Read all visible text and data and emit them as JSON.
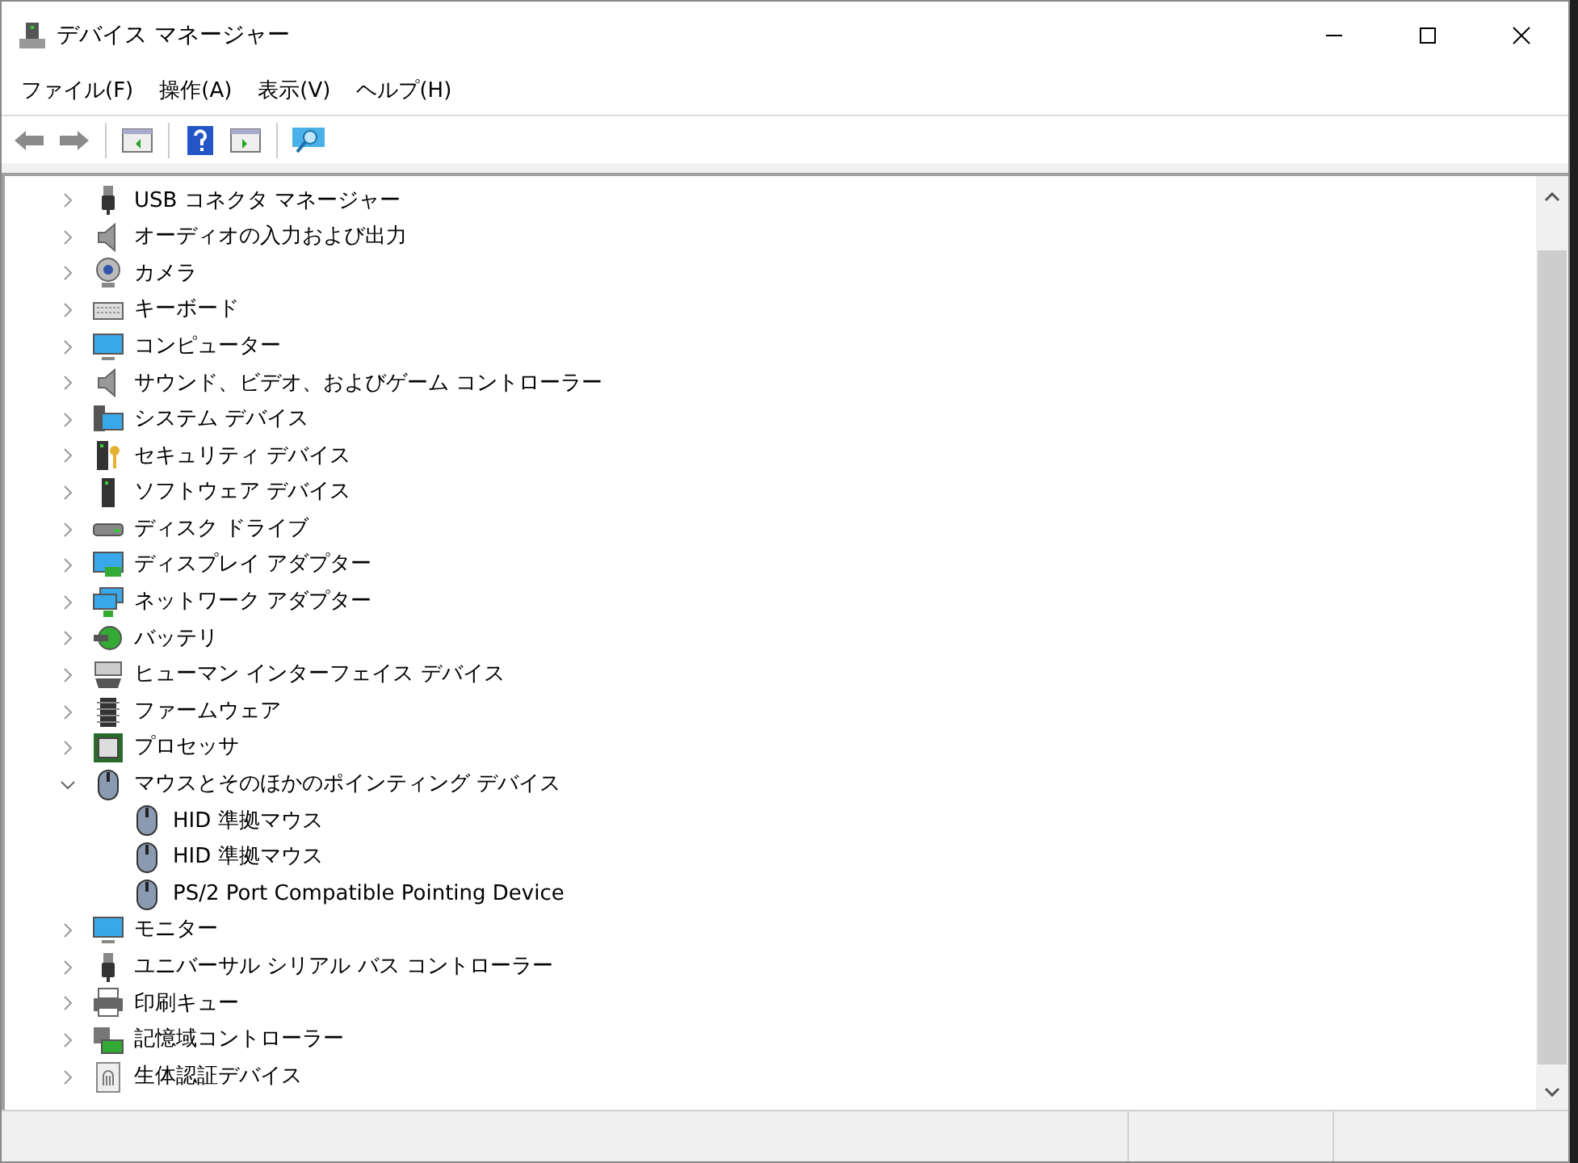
{
  "window": {
    "title": "デバイス マネージャー"
  },
  "menu": [
    "ファイル(F)",
    "操作(A)",
    "表示(V)",
    "ヘルプ(H)"
  ],
  "tree": [
    {
      "label": "USB コネクタ マネージャー",
      "expanded": false
    },
    {
      "label": "オーディオの入力および出力",
      "expanded": false
    },
    {
      "label": "カメラ",
      "expanded": false
    },
    {
      "label": "キーボード",
      "expanded": false
    },
    {
      "label": "コンピューター",
      "expanded": false
    },
    {
      "label": "サウンド、ビデオ、およびゲーム コントローラー",
      "expanded": false
    },
    {
      "label": "システム デバイス",
      "expanded": false
    },
    {
      "label": "セキュリティ デバイス",
      "expanded": false
    },
    {
      "label": "ソフトウェア デバイス",
      "expanded": false
    },
    {
      "label": "ディスク ドライブ",
      "expanded": false
    },
    {
      "label": "ディスプレイ アダプター",
      "expanded": false
    },
    {
      "label": "ネットワーク アダプター",
      "expanded": false
    },
    {
      "label": "バッテリ",
      "expanded": false
    },
    {
      "label": "ヒューマン インターフェイス デバイス",
      "expanded": false
    },
    {
      "label": "ファームウェア",
      "expanded": false
    },
    {
      "label": "プロセッサ",
      "expanded": false
    },
    {
      "label": "マウスとそのほかのポインティング デバイス",
      "expanded": true,
      "children": [
        {
          "label": "HID 準拠マウス"
        },
        {
          "label": "HID 準拠マウス"
        },
        {
          "label": "PS/2 Port Compatible Pointing Device"
        }
      ]
    },
    {
      "label": "モニター",
      "expanded": false
    },
    {
      "label": "ユニバーサル シリアル バス コントローラー",
      "expanded": false
    },
    {
      "label": "印刷キュー",
      "expanded": false
    },
    {
      "label": "記憶域コントローラー",
      "expanded": false
    },
    {
      "label": "生体認証デバイス",
      "expanded": false
    }
  ]
}
